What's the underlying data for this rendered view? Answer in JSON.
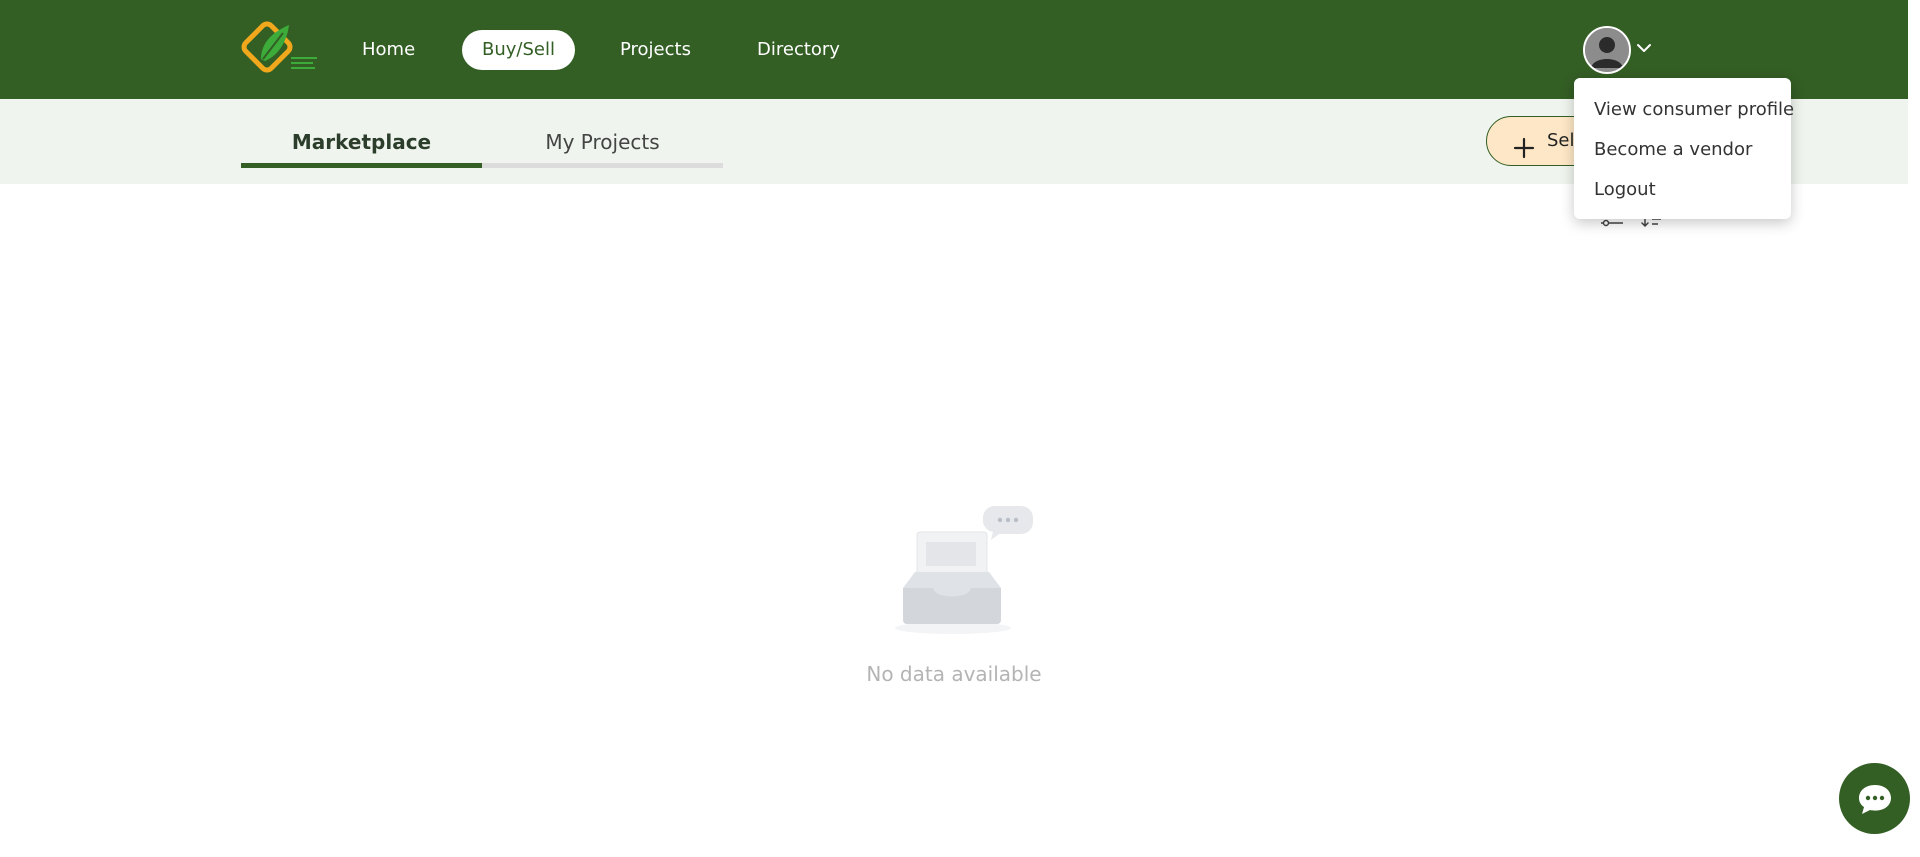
{
  "nav": {
    "items": [
      {
        "label": "Home"
      },
      {
        "label": "Buy/Sell",
        "active": true
      },
      {
        "label": "Projects"
      },
      {
        "label": "Directory"
      }
    ]
  },
  "tabs": [
    {
      "label": "Marketplace",
      "active": true
    },
    {
      "label": "My Projects"
    }
  ],
  "actions": {
    "sell_label": "Sel"
  },
  "user_menu": {
    "items": [
      {
        "label": "View consumer profile"
      },
      {
        "label": "Become a vendor"
      },
      {
        "label": "Logout"
      }
    ]
  },
  "empty_state": {
    "message": "No data available"
  },
  "icons": {
    "logo": "leaf-logo-icon",
    "avatar": "user-avatar-icon",
    "chevron": "chevron-down-icon",
    "plus": "plus-icon",
    "filter": "filter-sliders-icon",
    "sort": "sort-icon",
    "empty": "empty-inbox-icon",
    "chat": "chat-bubble-icon"
  },
  "colors": {
    "brand_green": "#335e24",
    "subbar_bg": "#eff5ee",
    "sell_bg": "#fde7c6",
    "muted_text": "#b4b4b4"
  }
}
